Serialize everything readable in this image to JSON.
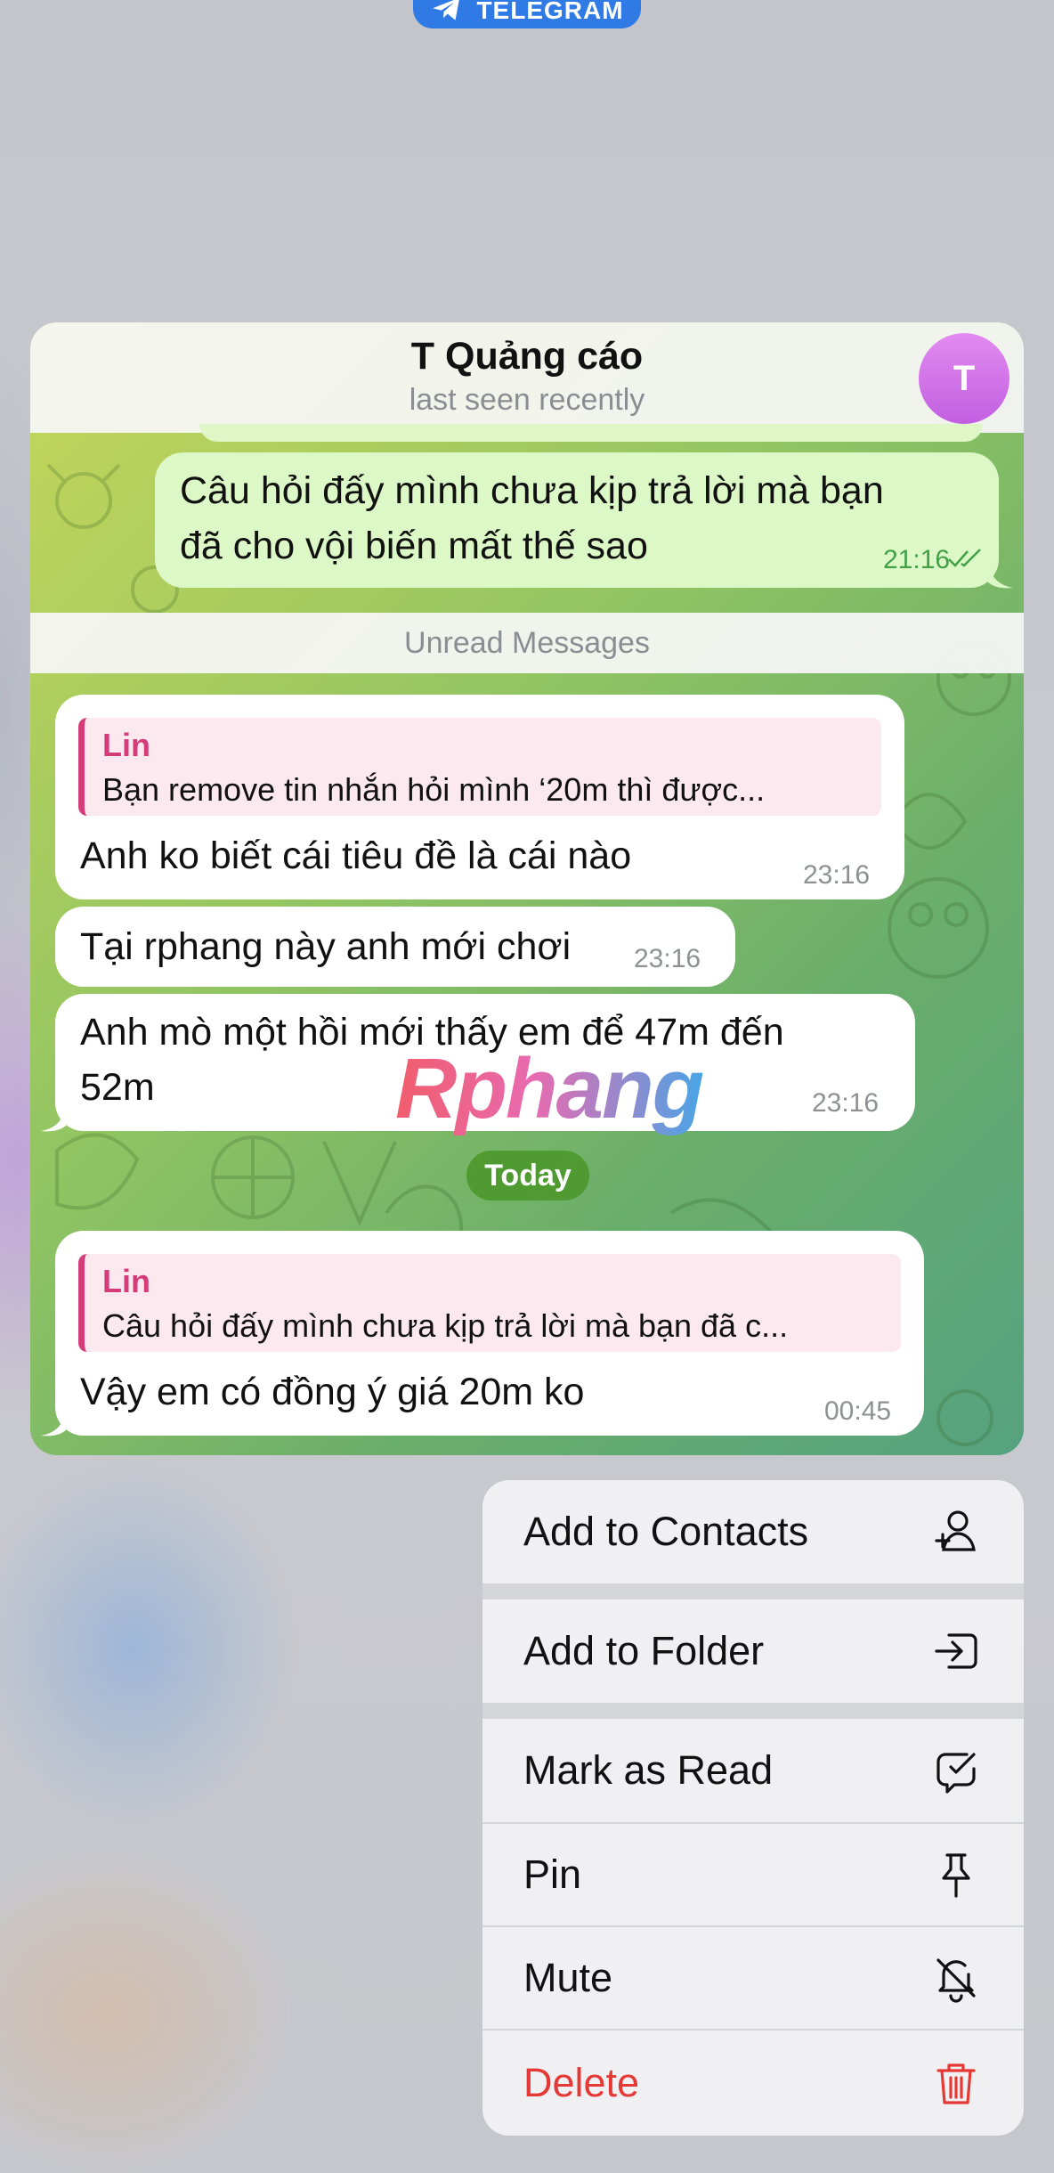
{
  "app_badge": {
    "label": "TELEGRAM"
  },
  "chat": {
    "title": "T Quảng cáo",
    "subtitle": "last seen recently",
    "avatar_letter": "T",
    "unread_label": "Unread Messages",
    "date_label": "Today",
    "watermark": "Rphang",
    "messages": [
      {
        "direction": "out",
        "lines": [
          "Câu hỏi đấy mình chưa kịp trả lời mà bạn",
          "đã cho vội biến mất thế sao"
        ],
        "time": "21:16",
        "read": true
      },
      {
        "direction": "in",
        "reply_name": "Lin",
        "reply_text": "Bạn remove tin nhắn hỏi mình ‘20m thì được...",
        "lines": [
          "Anh ko biết cái tiêu đề là cái nào"
        ],
        "time": "23:16"
      },
      {
        "direction": "in",
        "lines": [
          "Tại rphang này anh mới chơi"
        ],
        "time": "23:16"
      },
      {
        "direction": "in",
        "lines": [
          "Anh mò một hồi mới thấy em để 47m đến",
          "52m"
        ],
        "time": "23:16"
      },
      {
        "direction": "in",
        "reply_name": "Lin",
        "reply_text": "Câu hỏi đấy mình chưa kịp trả lời mà bạn đã c...",
        "lines": [
          "Vậy em có đồng ý giá 20m ko"
        ],
        "time": "00:45"
      }
    ]
  },
  "context_menu": {
    "items": [
      {
        "label": "Add to Contacts",
        "icon": "add-contact-icon"
      },
      {
        "label": "Add to Folder",
        "icon": "folder-enter-icon"
      },
      {
        "label": "Mark as Read",
        "icon": "mark-read-icon"
      },
      {
        "label": "Pin",
        "icon": "pin-icon"
      },
      {
        "label": "Mute",
        "icon": "bell-off-icon"
      },
      {
        "label": "Delete",
        "icon": "trash-icon",
        "destructive": true
      }
    ]
  },
  "colors": {
    "telegram_blue": "#2f7ae5",
    "outgoing_bubble": "#dcf8c6",
    "incoming_bubble": "#ffffff",
    "reply_accent": "#d43b79",
    "read_time": "#43a047",
    "destructive": "#e53935",
    "avatar": "#d27cea",
    "date_pill": "#4a9628"
  }
}
